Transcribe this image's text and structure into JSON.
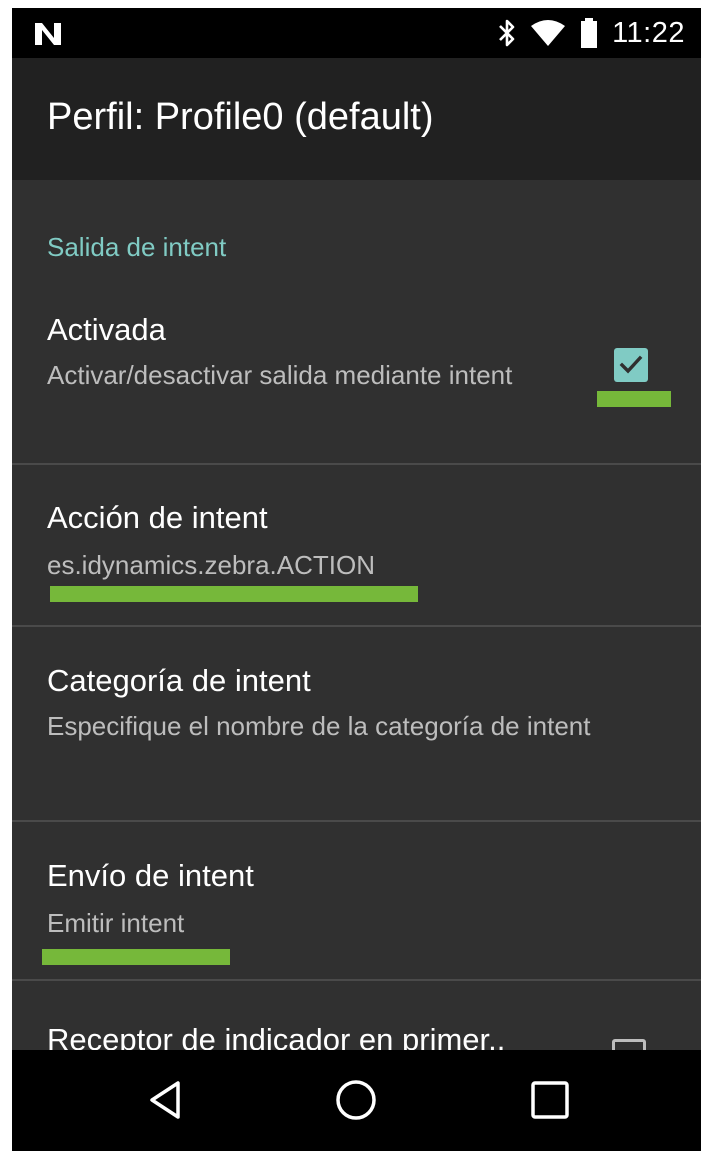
{
  "status_bar": {
    "time": "11:22",
    "icons": [
      "notification-n-icon",
      "bluetooth-icon",
      "wifi-icon",
      "battery-icon"
    ]
  },
  "app_bar": {
    "title": "Perfil: Profile0 (default)"
  },
  "section": {
    "header": "Salida de intent"
  },
  "preferences": [
    {
      "title": "Activada",
      "summary": "Activar/desactivar salida mediante intent",
      "checked": true
    },
    {
      "title": "Acción de intent",
      "summary": "es.idynamics.zebra.ACTION"
    },
    {
      "title": "Categoría de intent",
      "summary": "Especifique el nombre de la categoría de intent"
    },
    {
      "title": "Envío de intent",
      "summary": "Emitir intent"
    },
    {
      "title": "Receptor de indicador en primer..",
      "checked": false
    }
  ],
  "nav_bar": {
    "icons": [
      "back-icon",
      "home-icon",
      "recents-icon"
    ]
  },
  "colors": {
    "accent": "#80cbc4",
    "highlight": "#76b83a",
    "background": "#303030",
    "app_bar": "#212121"
  }
}
